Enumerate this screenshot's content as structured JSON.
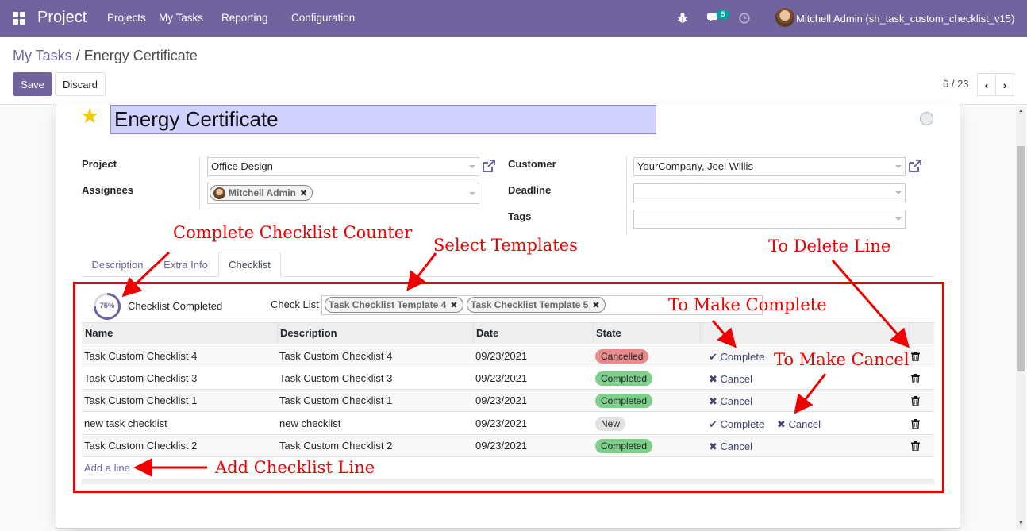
{
  "navbar": {
    "brand": "Project",
    "menu": [
      "Projects",
      "My Tasks",
      "Reporting",
      "Configuration"
    ],
    "messages_count": "5",
    "user_name": "Mitchell Admin (sh_task_custom_checklist_v15)"
  },
  "control_panel": {
    "breadcrumb_parent": "My Tasks",
    "breadcrumb_separator": "/",
    "breadcrumb_current": "Energy Certificate",
    "save_label": "Save",
    "discard_label": "Discard",
    "pager_value": "6 / 23"
  },
  "form": {
    "title": "Energy Certificate",
    "labels": {
      "project": "Project",
      "assignees": "Assignees",
      "customer": "Customer",
      "deadline": "Deadline",
      "tags": "Tags"
    },
    "values": {
      "project": "Office Design",
      "assignee": "Mitchell Admin",
      "customer": "YourCompany, Joel Willis",
      "deadline": "",
      "tags": ""
    }
  },
  "tabs": [
    "Description",
    "Extra Info",
    "Checklist"
  ],
  "checklist": {
    "progress_percent": 75,
    "progress_label": "75%",
    "completed_label": "Checklist Completed",
    "check_list_label": "Check List",
    "templates": [
      "Task Checklist Template 4",
      "Task Checklist Template 5"
    ],
    "columns": [
      "Name",
      "Description",
      "Date",
      "State"
    ],
    "rows": [
      {
        "name": "Task Custom Checklist 4",
        "description": "Task Custom Checklist 4",
        "date": "09/23/2021",
        "state": "Cancelled",
        "actions": [
          "Complete"
        ]
      },
      {
        "name": "Task Custom Checklist 3",
        "description": "Task Custom Checklist 3",
        "date": "09/23/2021",
        "state": "Completed",
        "actions": [
          "Cancel"
        ]
      },
      {
        "name": "Task Custom Checklist 1",
        "description": "Task Custom Checklist 1",
        "date": "09/23/2021",
        "state": "Completed",
        "actions": [
          "Cancel"
        ]
      },
      {
        "name": "new task checklist",
        "description": "new checklist",
        "date": "09/23/2021",
        "state": "New",
        "actions": [
          "Complete",
          "Cancel"
        ]
      },
      {
        "name": "Task Custom Checklist 2",
        "description": "Task Custom Checklist 2",
        "date": "09/23/2021",
        "state": "Completed",
        "actions": [
          "Cancel"
        ]
      }
    ],
    "add_line_label": "Add a line"
  },
  "annotations": {
    "counter": "Complete Checklist Counter",
    "templates": "Select Templates",
    "delete": "To Delete Line",
    "complete": "To Make Complete",
    "cancel": "To Make Cancel",
    "add_line": "Add Checklist Line"
  },
  "colors": {
    "brand": "#71639e",
    "annotation_red": "#ee0000",
    "cancelled": "#e88b8b",
    "completed": "#7dcf8a",
    "new": "#e2e2e2"
  }
}
